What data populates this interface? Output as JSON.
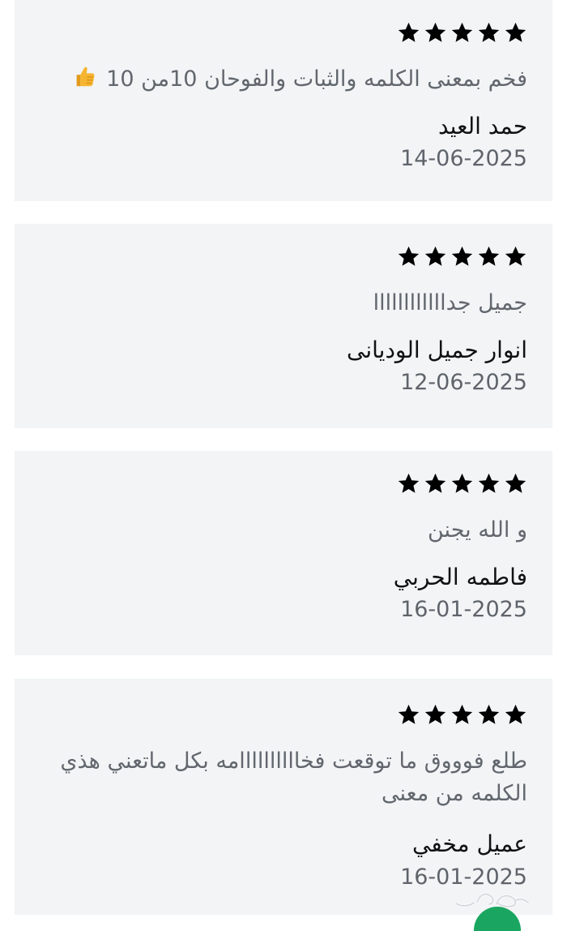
{
  "reviews": [
    {
      "rating": 5,
      "text": "فخم بمعنى الكلمه والثبات والفوحان 10من 10",
      "emoji": "thumbs-up-icon",
      "author": "حمد العيد",
      "date": "14-06-2025"
    },
    {
      "rating": 5,
      "text": "جميل جداااااااااااا",
      "author": "انوار جميل الوديانى",
      "date": "12-06-2025"
    },
    {
      "rating": 5,
      "text": "و الله يجنن",
      "author": "فاطمه الحربي",
      "date": "16-01-2025"
    },
    {
      "rating": 5,
      "text": "طلع فوووق ما توقعت فخاااااااااامه بكل ماتعني هذي الكلمه من معنى",
      "author": "عميل مخفي",
      "date": "16-01-2025"
    }
  ],
  "colors": {
    "card_bg": "#f2f4f6",
    "star": "#000000",
    "text_gray": "#62676e",
    "author": "#111111",
    "thumbs": "#f6b531",
    "fab": "#1aa660"
  }
}
